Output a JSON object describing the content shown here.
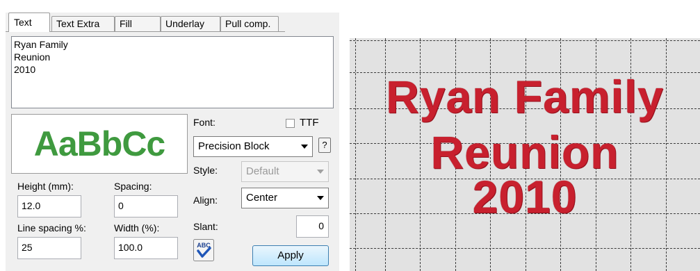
{
  "tabs": [
    "Text",
    "Text Extra",
    "Fill",
    "Underlay",
    "Pull comp."
  ],
  "text_content": "Ryan Family\nReunion\n2010",
  "sample_text": "AaBbCc",
  "font": {
    "label": "Font:",
    "value": "Precision Block",
    "ttf_label": "TTF",
    "ttf_checked": false,
    "help": "?"
  },
  "style": {
    "label": "Style:",
    "value": "Default",
    "enabled": false
  },
  "align": {
    "label": "Align:",
    "value": "Center"
  },
  "slant": {
    "label": "Slant:",
    "value": "0"
  },
  "height": {
    "label": "Height (mm):",
    "value": "12.0"
  },
  "spacing": {
    "label": "Spacing:",
    "value": "0"
  },
  "line_spacing": {
    "label": "Line spacing %:",
    "value": "25"
  },
  "width": {
    "label": "Width (%):",
    "value": "100.0"
  },
  "spellcheck_icon_text": "ABC",
  "apply_label": "Apply",
  "canvas_lines": [
    "Ryan Family",
    "Reunion",
    "2010"
  ],
  "colors": {
    "sample_green": "#3f9a3f",
    "stitch_red": "#c8202e",
    "canvas_bg": "#e2e2e2"
  }
}
